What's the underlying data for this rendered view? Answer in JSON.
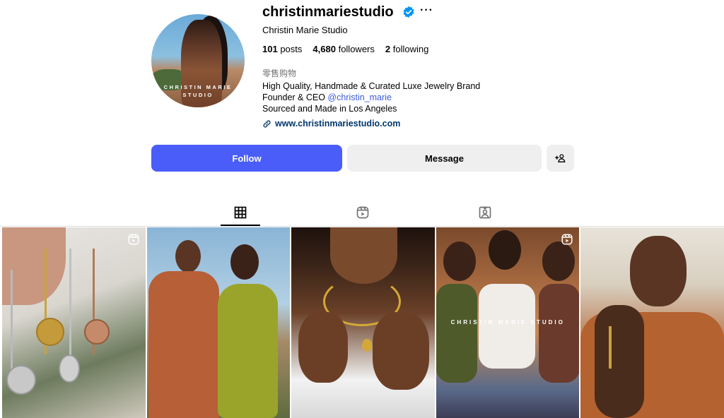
{
  "profile": {
    "username": "christinmariestudio",
    "full_name": "Christin Marie Studio",
    "avatar_watermark_line1": "CHRISTIN MARIE",
    "avatar_watermark_line2": "STUDIO",
    "more_label": "···"
  },
  "stats": {
    "posts_count": "101",
    "posts_label": "posts",
    "followers_count": "4,680",
    "followers_label": "followers",
    "following_count": "2",
    "following_label": "following"
  },
  "bio": {
    "category": "零售购物",
    "line1": "High Quality, Handmade & Curated Luxe Jewelry Brand",
    "line2_prefix": "Founder & CEO ",
    "line2_mention": "@christin_marie",
    "line3": "Sourced and Made in Los Angeles",
    "website": "www.christinmariestudio.com"
  },
  "actions": {
    "follow_label": "Follow",
    "message_label": "Message"
  },
  "tabs": [
    {
      "name": "posts",
      "icon": "grid-icon",
      "active": true
    },
    {
      "name": "reels",
      "icon": "reels-icon",
      "active": false
    },
    {
      "name": "tagged",
      "icon": "tagged-icon",
      "active": false
    }
  ],
  "grid": {
    "tile4_watermark": "CHRISTIN MARIE STUDIO"
  },
  "colors": {
    "follow_button": "#4a5df9",
    "verified_badge": "#0095f6",
    "link": "#00376b"
  }
}
